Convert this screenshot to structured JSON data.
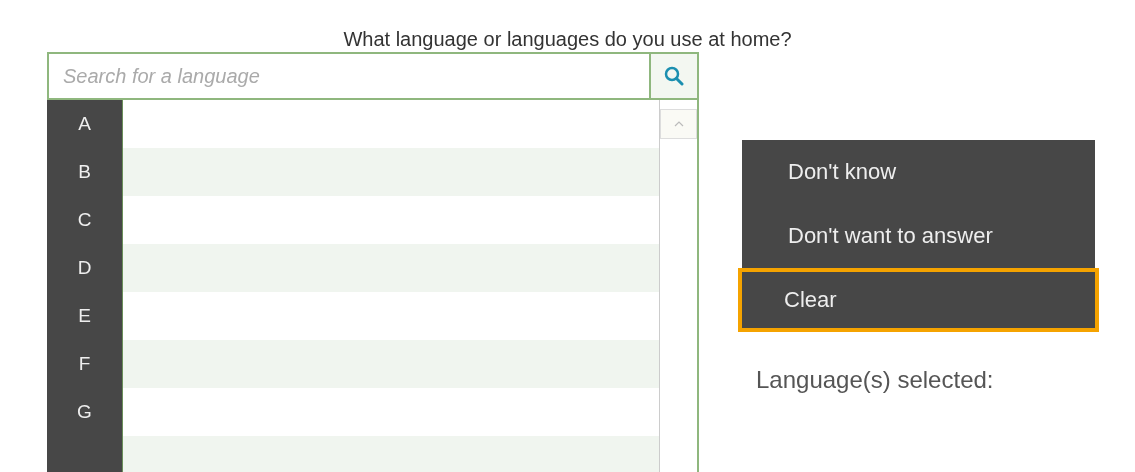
{
  "question": "What language or languages do you use at home?",
  "search": {
    "placeholder": "Search for a language"
  },
  "letters": [
    "A",
    "B",
    "C",
    "D",
    "E",
    "F",
    "G"
  ],
  "options": [
    {
      "label": "Don't know",
      "focused": false
    },
    {
      "label": "Don't want to answer",
      "focused": false
    },
    {
      "label": "Clear",
      "focused": true
    }
  ],
  "selected_label": "Language(s) selected:"
}
